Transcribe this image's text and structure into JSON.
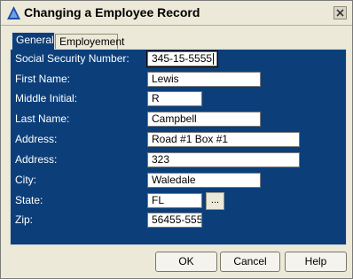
{
  "window": {
    "title": "Changing a Employee Record"
  },
  "tabs": [
    {
      "label": "General",
      "active": true
    },
    {
      "label": "Employement",
      "active": false
    }
  ],
  "form": {
    "ssn": {
      "label": "Social Security Number:",
      "value": "345-15-5555"
    },
    "first_name": {
      "label": "First Name:",
      "value": "Lewis"
    },
    "middle_initial": {
      "label": "Middle Initial:",
      "value": "R"
    },
    "last_name": {
      "label": "Last Name:",
      "value": "Campbell"
    },
    "address1": {
      "label": "Address:",
      "value": "Road #1 Box #1"
    },
    "address2": {
      "label": "Address:",
      "value": "323"
    },
    "city": {
      "label": "City:",
      "value": "Waledale"
    },
    "state": {
      "label": "State:",
      "value": "FL",
      "button_label": "..."
    },
    "zip": {
      "label": "Zip:",
      "value": "56455-555"
    }
  },
  "buttons": {
    "ok": "OK",
    "cancel": "Cancel",
    "help": "Help"
  },
  "colors": {
    "panel": "#0c3f7a",
    "window": "#ece9d8",
    "label_text": "#ffffff"
  },
  "icons": {
    "app": "triangle-app-icon",
    "close": "close-x-icon"
  }
}
